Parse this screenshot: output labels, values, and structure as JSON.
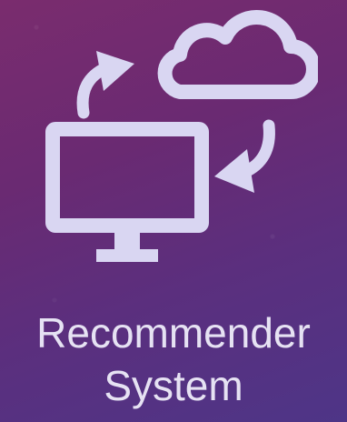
{
  "title": {
    "line1": "Recommender",
    "line2": "System"
  },
  "icons": [
    "cloud-icon",
    "monitor-icon",
    "sync-arrow-icon"
  ],
  "colors": {
    "icon": "#d9d6f2",
    "text": "#e6e2f3",
    "background_top": "#7a2c6e",
    "background_bottom": "#4e3587"
  }
}
